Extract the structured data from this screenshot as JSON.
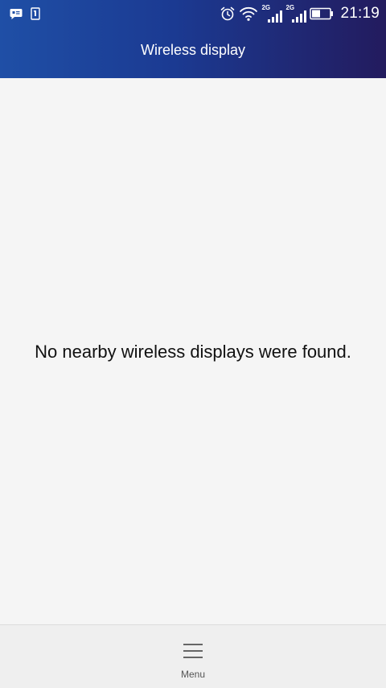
{
  "status_bar": {
    "left_icons": [
      "message-notification-icon",
      "sim-card-icon"
    ],
    "right_icons": [
      "alarm-icon",
      "wifi-icon",
      "signal-icon",
      "signal-icon",
      "battery-icon"
    ],
    "network_type_1": "2G",
    "network_type_2": "2G",
    "time": "21:19"
  },
  "header": {
    "title": "Wireless display"
  },
  "main": {
    "empty_message": "No nearby wireless displays were found."
  },
  "bottom_bar": {
    "menu_label": "Menu",
    "menu_icon": "hamburger-menu-icon"
  },
  "colors": {
    "header_gradient_start": "#1f4fa6",
    "header_gradient_end": "#231b5e",
    "background": "#f5f5f5",
    "bottom_bar": "#efefef"
  }
}
